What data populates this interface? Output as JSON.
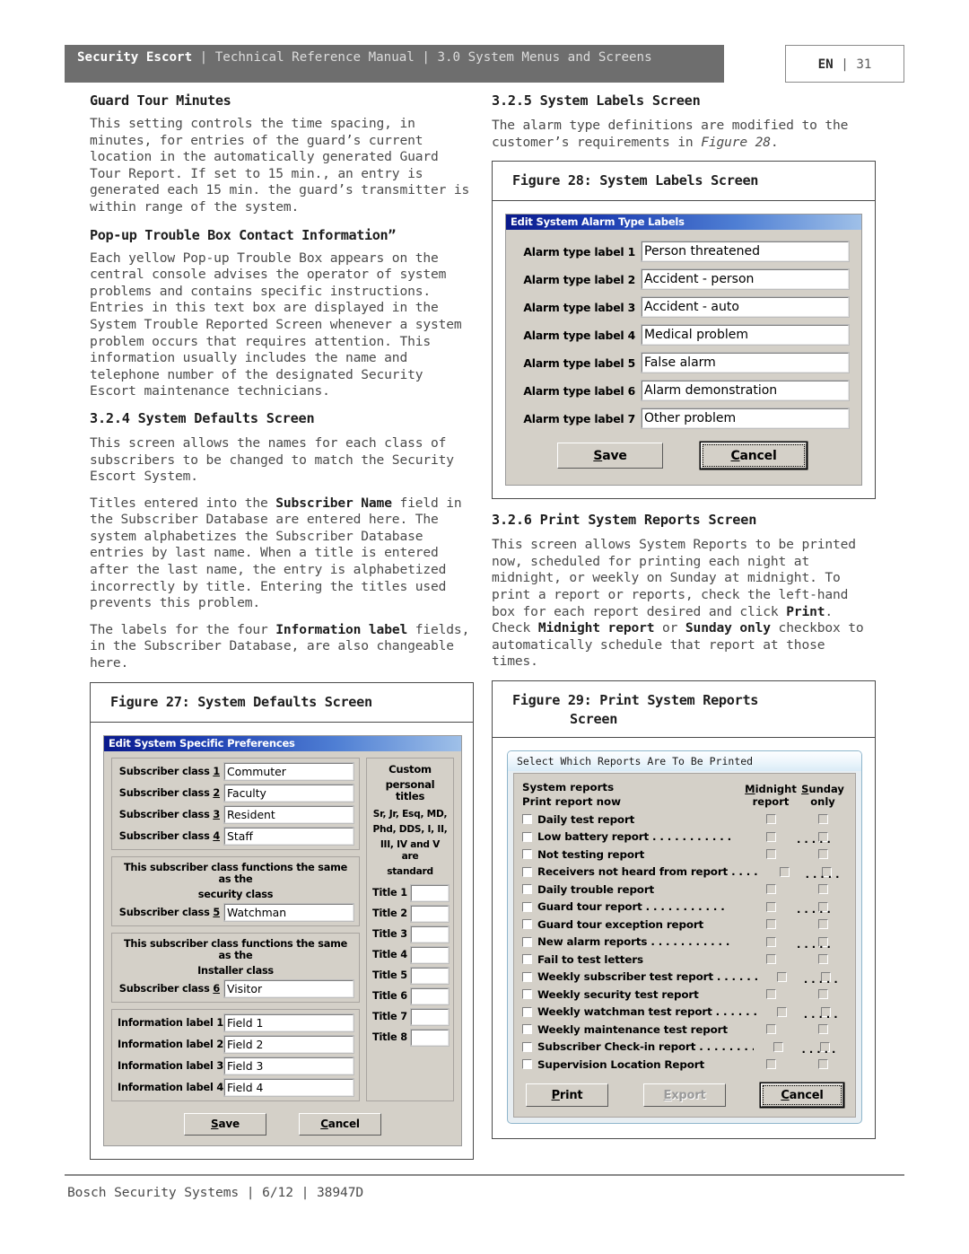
{
  "header": {
    "brand": "Security Escort",
    "sep": " | ",
    "manual": "Technical Reference Manual",
    "section": "3.0  System Menus and Screens",
    "full_left": "Security Escort | Technical Reference Manual | 3.0  System Menus and Screens",
    "lang": "EN",
    "lang_sep": "|",
    "page": "31"
  },
  "left_column": {
    "h_guard_tour": "Guard Tour Minutes",
    "p_guard_tour": "This setting controls the time spacing, in minutes, for entries of the guard’s current location in the automatically generated Guard Tour Report. If set to 15 min., an entry is generated each 15 min. the guard’s transmitter is within range of the system.",
    "h_popup": "Pop-up Trouble Box Contact Information”",
    "p_popup": "Each yellow Pop-up Trouble Box appears on the central console advises the operator of system problems and contains specific instructions. Entries in this text box are displayed in the System Trouble Reported Screen whenever a system problem occurs that requires attention. This information usually includes the name and telephone number of the designated Security Escort maintenance technicians.",
    "h_324": "3.2.4 System Defaults Screen",
    "p_324_1": "This screen allows the names for each class of subscribers to be changed to match the Security Escort System.",
    "p_324_2a": "Titles entered into the ",
    "p_324_2b": "Subscriber Name",
    "p_324_2c": " field in the Subscriber Database are entered here. The system alphabetizes the Subscriber Database entries by last name. When a title is entered after the last name, the entry is alphabetized incorrectly by title. Entering the titles used prevents this problem.",
    "p_324_3a": "The labels for the four ",
    "p_324_3b": "Information label",
    "p_324_3c": " fields, in the Subscriber Database, are also changeable here.",
    "figure27_caption": "Figure 27:   System Defaults Screen"
  },
  "right_column": {
    "h_325": "3.2.5 System Labels Screen",
    "p_325a": "The alarm type definitions are modified to the customer’s requirements in ",
    "p_325b": "Figure 28",
    "p_325c": ".",
    "figure28_caption": "Figure 28:   System Labels Screen",
    "h_326": "3.2.6 Print System Reports Screen",
    "p_326_a": "This screen allows System Reports to be printed now, scheduled for printing each night at midnight, or weekly on Sunday at midnight. To print a report or reports, check the left-hand box for each report desired and click ",
    "p_326_b": "Print",
    "p_326_c": ". Check ",
    "p_326_d": "Midnight report",
    "p_326_e": " or ",
    "p_326_f": "Sunday only",
    "p_326_g": " checkbox to automatically schedule that report at those times.",
    "figure29_caption_line1": "Figure 29:   Print System Reports",
    "figure29_caption_line2": "Screen"
  },
  "dialog_defaults": {
    "title": "Edit System Specific Preferences",
    "subscriber_classes_top": [
      {
        "label": "Subscriber class ",
        "num": "1",
        "value": "Commuter"
      },
      {
        "label": "Subscriber class ",
        "num": "2",
        "value": "Faculty"
      },
      {
        "label": "Subscriber class ",
        "num": "3",
        "value": "Resident"
      },
      {
        "label": "Subscriber class ",
        "num": "4",
        "value": "Staff"
      }
    ],
    "security_group": {
      "caption_line1": "This subscriber class functions the same as the",
      "caption_line2": "security class",
      "label": "Subscriber class ",
      "num": "5",
      "value": "Watchman"
    },
    "installer_group": {
      "caption_line1": "This subscriber class functions the same as the",
      "caption_line2": "Installer class",
      "label": "Subscriber class ",
      "num": "6",
      "value": "Visitor"
    },
    "information_labels": [
      {
        "label": "Information label 1",
        "value": "Field 1"
      },
      {
        "label": "Information label 2",
        "value": "Field 2"
      },
      {
        "label": "Information label 3",
        "value": "Field 3"
      },
      {
        "label": "Information label 4",
        "value": "Field 4"
      }
    ],
    "titles_panel": {
      "heading_line1": "Custom",
      "heading_line2": "personal titles",
      "note_line1": "Sr, Jr, Esq, MD,",
      "note_line2": "Phd, DDS, I, II,",
      "note_line3": "III, IV and V are",
      "note_line4": "standard",
      "titles": [
        {
          "label": "Title 1",
          "value": ""
        },
        {
          "label": "Title 2",
          "value": ""
        },
        {
          "label": "Title 3",
          "value": ""
        },
        {
          "label": "Title 4",
          "value": ""
        },
        {
          "label": "Title 5",
          "value": ""
        },
        {
          "label": "Title 6",
          "value": ""
        },
        {
          "label": "Title 7",
          "value": ""
        },
        {
          "label": "Title 8",
          "value": ""
        }
      ]
    },
    "save_label": "Save",
    "cancel_label": "Cancel"
  },
  "dialog_alarm_labels": {
    "title": "Edit System Alarm Type Labels",
    "rows": [
      {
        "label": "Alarm type label 1",
        "value": "Person threatened"
      },
      {
        "label": "Alarm type label 2",
        "value": "Accident - person"
      },
      {
        "label": "Alarm type label 3",
        "value": "Accident - auto"
      },
      {
        "label": "Alarm type label 4",
        "value": "Medical problem"
      },
      {
        "label": "Alarm type label 5",
        "value": "False alarm"
      },
      {
        "label": "Alarm type label 6",
        "value": "Alarm demonstration"
      },
      {
        "label": "Alarm type label 7",
        "value": "Other problem"
      }
    ],
    "save_label": "Save",
    "cancel_label": "Cancel"
  },
  "dialog_print_reports": {
    "title": "Select Which Reports Are To Be Printed",
    "col_header_left_line1": "System reports",
    "col_header_left_line2": "Print report now",
    "col_header_mid_line1": "Midnight",
    "col_header_mid_line2": "report",
    "col_header_right_line1": "Sunday",
    "col_header_right_line2": "only",
    "reports": [
      {
        "label": "Daily test report",
        "dots": false,
        "checked": false,
        "midnight": false,
        "sunday": false
      },
      {
        "label": "Low battery report",
        "dots": true,
        "checked": false,
        "midnight": false,
        "sunday": false
      },
      {
        "label": "Not testing report",
        "dots": false,
        "checked": false,
        "midnight": false,
        "sunday": false
      },
      {
        "label": "Receivers not heard from report",
        "dots": true,
        "checked": false,
        "midnight": false,
        "sunday": false
      },
      {
        "label": "Daily trouble report",
        "dots": false,
        "checked": false,
        "midnight": false,
        "sunday": false
      },
      {
        "label": "Guard tour report",
        "dots": true,
        "checked": false,
        "midnight": false,
        "sunday": false
      },
      {
        "label": "Guard tour exception report",
        "dots": false,
        "checked": false,
        "midnight": false,
        "sunday": false
      },
      {
        "label": "New alarm reports",
        "dots": true,
        "checked": false,
        "midnight": false,
        "sunday": false
      },
      {
        "label": "Fail to test letters",
        "dots": false,
        "checked": false,
        "midnight": false,
        "sunday": false
      },
      {
        "label": "Weekly subscriber test report",
        "dots": true,
        "checked": false,
        "midnight": false,
        "sunday": false
      },
      {
        "label": "Weekly security test report",
        "dots": false,
        "checked": false,
        "midnight": false,
        "sunday": false
      },
      {
        "label": "Weekly watchman test report",
        "dots": true,
        "checked": false,
        "midnight": false,
        "sunday": false
      },
      {
        "label": "Weekly maintenance test report",
        "dots": false,
        "checked": false,
        "midnight": false,
        "sunday": false
      },
      {
        "label": "Subscriber Check-in report",
        "dots": true,
        "checked": false,
        "midnight": false,
        "sunday": false
      },
      {
        "label": "Supervision Location Report",
        "dots": false,
        "checked": false,
        "midnight": false,
        "sunday": false
      }
    ],
    "print_label": "Print",
    "export_label": "Export",
    "cancel_label": "Cancel"
  },
  "footer": {
    "text": "Bosch Security Systems | 6/12 | 38947D"
  }
}
